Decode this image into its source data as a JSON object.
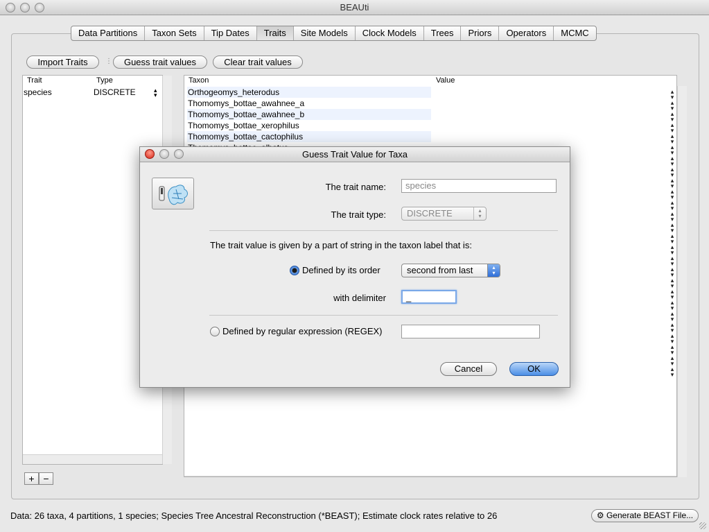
{
  "window": {
    "title": "BEAUti"
  },
  "tabs": [
    {
      "label": "Data Partitions"
    },
    {
      "label": "Taxon Sets"
    },
    {
      "label": "Tip Dates"
    },
    {
      "label": "Traits"
    },
    {
      "label": "Site Models"
    },
    {
      "label": "Clock Models"
    },
    {
      "label": "Trees"
    },
    {
      "label": "Priors"
    },
    {
      "label": "Operators"
    },
    {
      "label": "MCMC"
    }
  ],
  "active_tab": "Traits",
  "toolbar": {
    "import_traits": "Import Traits",
    "guess_trait_values": "Guess trait values",
    "clear_trait_values": "Clear trait values"
  },
  "trait_table": {
    "headers": {
      "trait": "Trait",
      "type": "Type"
    },
    "rows": [
      {
        "trait": "species",
        "type": "DISCRETE"
      }
    ]
  },
  "list_buttons": {
    "add": "+",
    "remove": "−"
  },
  "taxon_table": {
    "headers": {
      "taxon": "Taxon",
      "value": "Value"
    },
    "rows": [
      "Orthogeomys_heterodus",
      "Thomomys_bottae_awahnee_a",
      "Thomomys_bottae_awahnee_b",
      "Thomomys_bottae_xerophilus",
      "Thomomys_bottae_cactophilus",
      "Thomomys_bottae_albatus"
    ]
  },
  "status_bar": {
    "text": "Data: 26 taxa, 4 partitions, 1 species; Species Tree Ancestral Reconstruction (*BEAST); Estimate clock rates relative to 26",
    "generate_button": "Generate BEAST File..."
  },
  "dialog": {
    "title": "Guess Trait Value for Taxa",
    "trait_name_label": "The trait name:",
    "trait_name_value": "species",
    "trait_type_label": "The trait type:",
    "trait_type_value": "DISCRETE",
    "instruction": "The trait value is given by a part of string in the taxon label that is:",
    "order_option_label": "Defined by its order",
    "order_option_selected": true,
    "order_value": "second from last",
    "delimiter_label": "with delimiter",
    "delimiter_value": "_",
    "regex_option_label": "Defined by regular expression (REGEX)",
    "regex_value": "",
    "cancel_button": "Cancel",
    "ok_button": "OK"
  },
  "colors": {
    "accent_blue": "#3d7fe0",
    "row_highlight": "#edf3fe",
    "close_red": "#d8281a"
  }
}
